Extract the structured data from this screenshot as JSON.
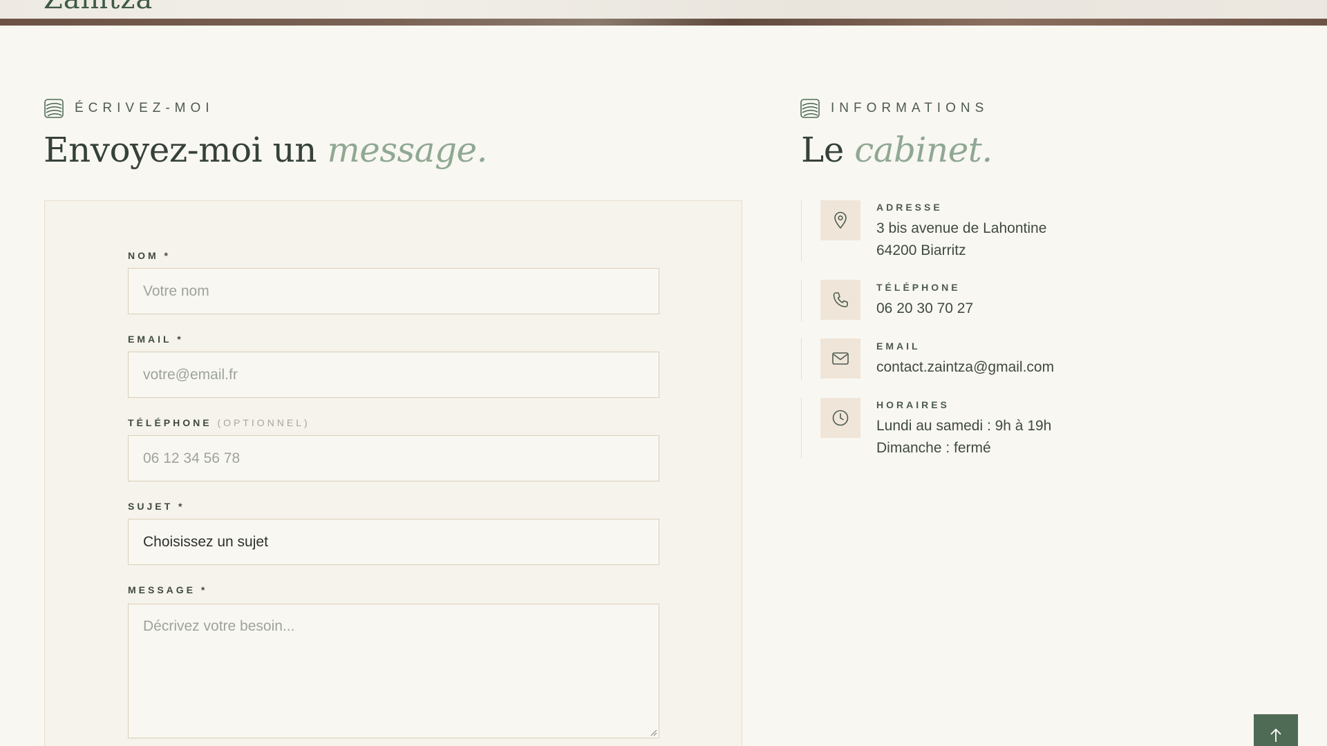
{
  "header": {
    "brand": "Zaintza"
  },
  "contact_form": {
    "eyebrow": "ÉCRIVEZ-MOI",
    "title_main": "Envoyez-moi un",
    "title_accent": "message.",
    "fields": {
      "name": {
        "label": "NOM *",
        "placeholder": "Votre nom"
      },
      "email": {
        "label": "EMAIL *",
        "placeholder": "votre@email.fr"
      },
      "phone": {
        "label": "TÉLÉPHONE",
        "optional": "(OPTIONNEL)",
        "placeholder": "06 12 34 56 78"
      },
      "subject": {
        "label": "SUJET *",
        "value": "Choisissez un sujet"
      },
      "message": {
        "label": "MESSAGE *",
        "placeholder": "Décrivez votre besoin..."
      }
    }
  },
  "info": {
    "eyebrow": "INFORMATIONS",
    "title_main": "Le",
    "title_accent": "cabinet.",
    "items": [
      {
        "label": "ADRESSE",
        "icon": "map-pin-icon",
        "lines": [
          "3 bis avenue de Lahontine",
          "64200 Biarritz"
        ]
      },
      {
        "label": "TÉLÉPHONE",
        "icon": "phone-icon",
        "lines": [
          "06 20 30 70 27"
        ]
      },
      {
        "label": "EMAIL",
        "icon": "mail-icon",
        "lines": [
          "contact.zaintza@gmail.com"
        ]
      },
      {
        "label": "HORAIRES",
        "icon": "clock-icon",
        "lines": [
          "Lundi au samedi : 9h à 19h",
          "Dimanche : fermé"
        ]
      }
    ]
  },
  "colors": {
    "background": "#f9f7f2",
    "accent_green": "#8fa893",
    "button_green": "#4f6b55",
    "icon_box": "#efe6d9"
  }
}
